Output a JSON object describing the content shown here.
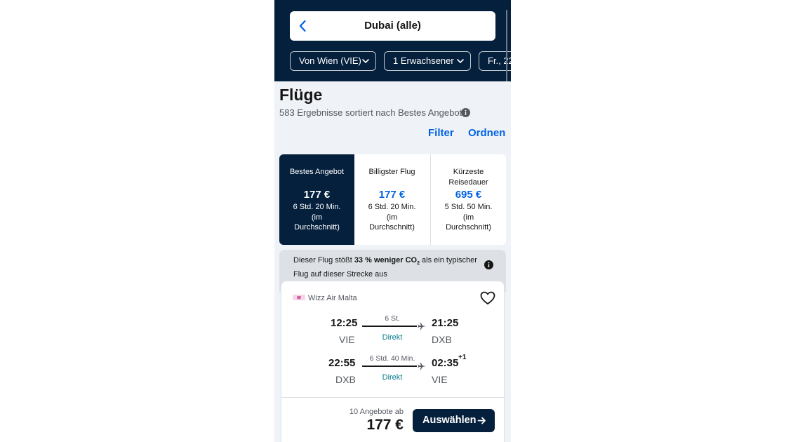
{
  "header": {
    "search_title": "Dubai (alle)",
    "chips": [
      "Von Wien (VIE)",
      "1 Erwachsener",
      "Fr., 22"
    ]
  },
  "page": {
    "title": "Flüge",
    "results_text": "583 Ergebnisse sortiert nach Bestes Angebot",
    "filter_label": "Filter",
    "sort_label": "Ordnen"
  },
  "tabs": [
    {
      "label": "Bestes Angebot",
      "price": "177 €",
      "duration": "6 Std. 20 Min. (im Durchschnitt)",
      "active": true
    },
    {
      "label": "Billigster Flug",
      "price": "177 €",
      "duration": "6 Std. 20 Min. (im Durchschnitt)",
      "active": false
    },
    {
      "label": "Kürzeste Reisedauer",
      "price": "695 €",
      "duration": "5 Std. 50 Min. (im Durchschnitt)",
      "active": false
    }
  ],
  "eco": {
    "text_before": "Dieser Flug stößt ",
    "highlight": "33 % weniger CO",
    "sub": "2",
    "text_after": " als ein typischer Flug auf dieser Strecke aus"
  },
  "card": {
    "airline": "Wizz Air Malta",
    "legs": [
      {
        "dep_time": "12:25",
        "dep_code": "VIE",
        "duration": "6 St.",
        "stops": "Direkt",
        "arr_time": "21:25",
        "arr_code": "DXB",
        "day_offset": ""
      },
      {
        "dep_time": "22:55",
        "dep_code": "DXB",
        "duration": "6 Std. 40 Min.",
        "stops": "Direkt",
        "arr_time": "02:35",
        "arr_code": "VIE",
        "day_offset": "+1"
      }
    ],
    "offers_text": "10 Angebote ab",
    "price": "177 €",
    "select_label": "Auswählen"
  },
  "colors": {
    "navy": "#05203c",
    "link_blue": "#0062e3",
    "teal": "#007a8c",
    "background": "#eff3f8"
  }
}
